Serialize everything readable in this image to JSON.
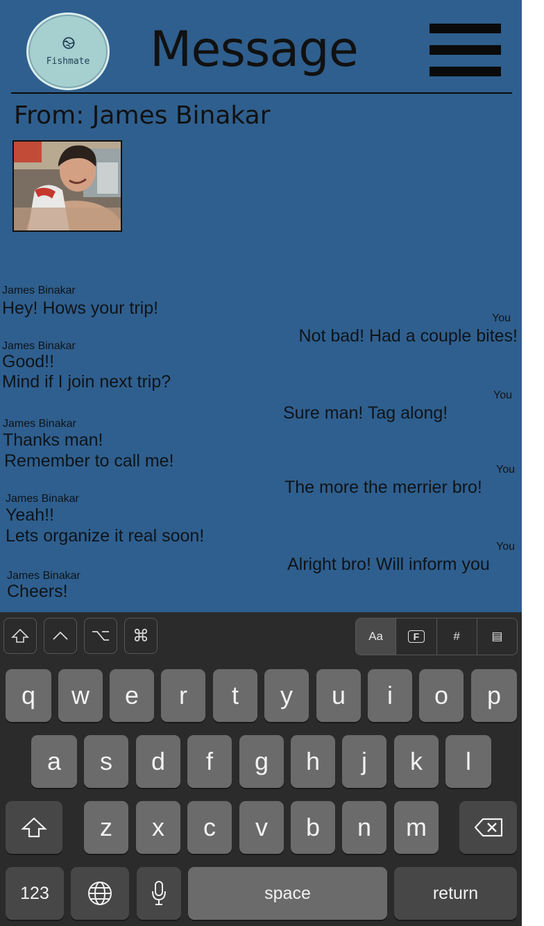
{
  "header": {
    "logo_text": "Fishmate",
    "title": "Message"
  },
  "sender": {
    "from_label": "From: James Binakar"
  },
  "messages": [
    {
      "side": "left",
      "label": "James Binakar",
      "lines": [
        "Hey! Hows your trip!"
      ]
    },
    {
      "side": "right",
      "label": "You",
      "lines": [
        "Not bad! Had a couple bites!"
      ]
    },
    {
      "side": "left",
      "label": "James Binakar",
      "lines": [
        "Good!!",
        "Mind if I join next trip?"
      ]
    },
    {
      "side": "right",
      "label": "You",
      "lines": [
        "Sure man! Tag along!"
      ]
    },
    {
      "side": "left",
      "label": "James Binakar",
      "lines": [
        "Thanks man!",
        "Remember to call me!"
      ]
    },
    {
      "side": "right",
      "label": "You",
      "lines": [
        "The more the merrier bro!"
      ]
    },
    {
      "side": "left",
      "label": "James Binakar",
      "lines": [
        "Yeah!!",
        "Lets organize it real soon!"
      ]
    },
    {
      "side": "right",
      "label": "You",
      "lines": [
        "Alright bro! Will inform you"
      ]
    },
    {
      "side": "left",
      "label": "James Binakar",
      "lines": [
        "Cheers!"
      ]
    }
  ],
  "keyboard": {
    "toolbar_left": [
      "⇧",
      "^",
      "⌥",
      "⌘"
    ],
    "toolbar_right": [
      "Aa",
      "F",
      "#",
      "▤"
    ],
    "row1": [
      "q",
      "w",
      "e",
      "r",
      "t",
      "y",
      "u",
      "i",
      "o",
      "p"
    ],
    "row2": [
      "a",
      "s",
      "d",
      "f",
      "g",
      "h",
      "j",
      "k",
      "l"
    ],
    "row3": [
      "z",
      "x",
      "c",
      "v",
      "b",
      "n",
      "m"
    ],
    "numbers_label": "123",
    "space_label": "space",
    "return_label": "return"
  }
}
